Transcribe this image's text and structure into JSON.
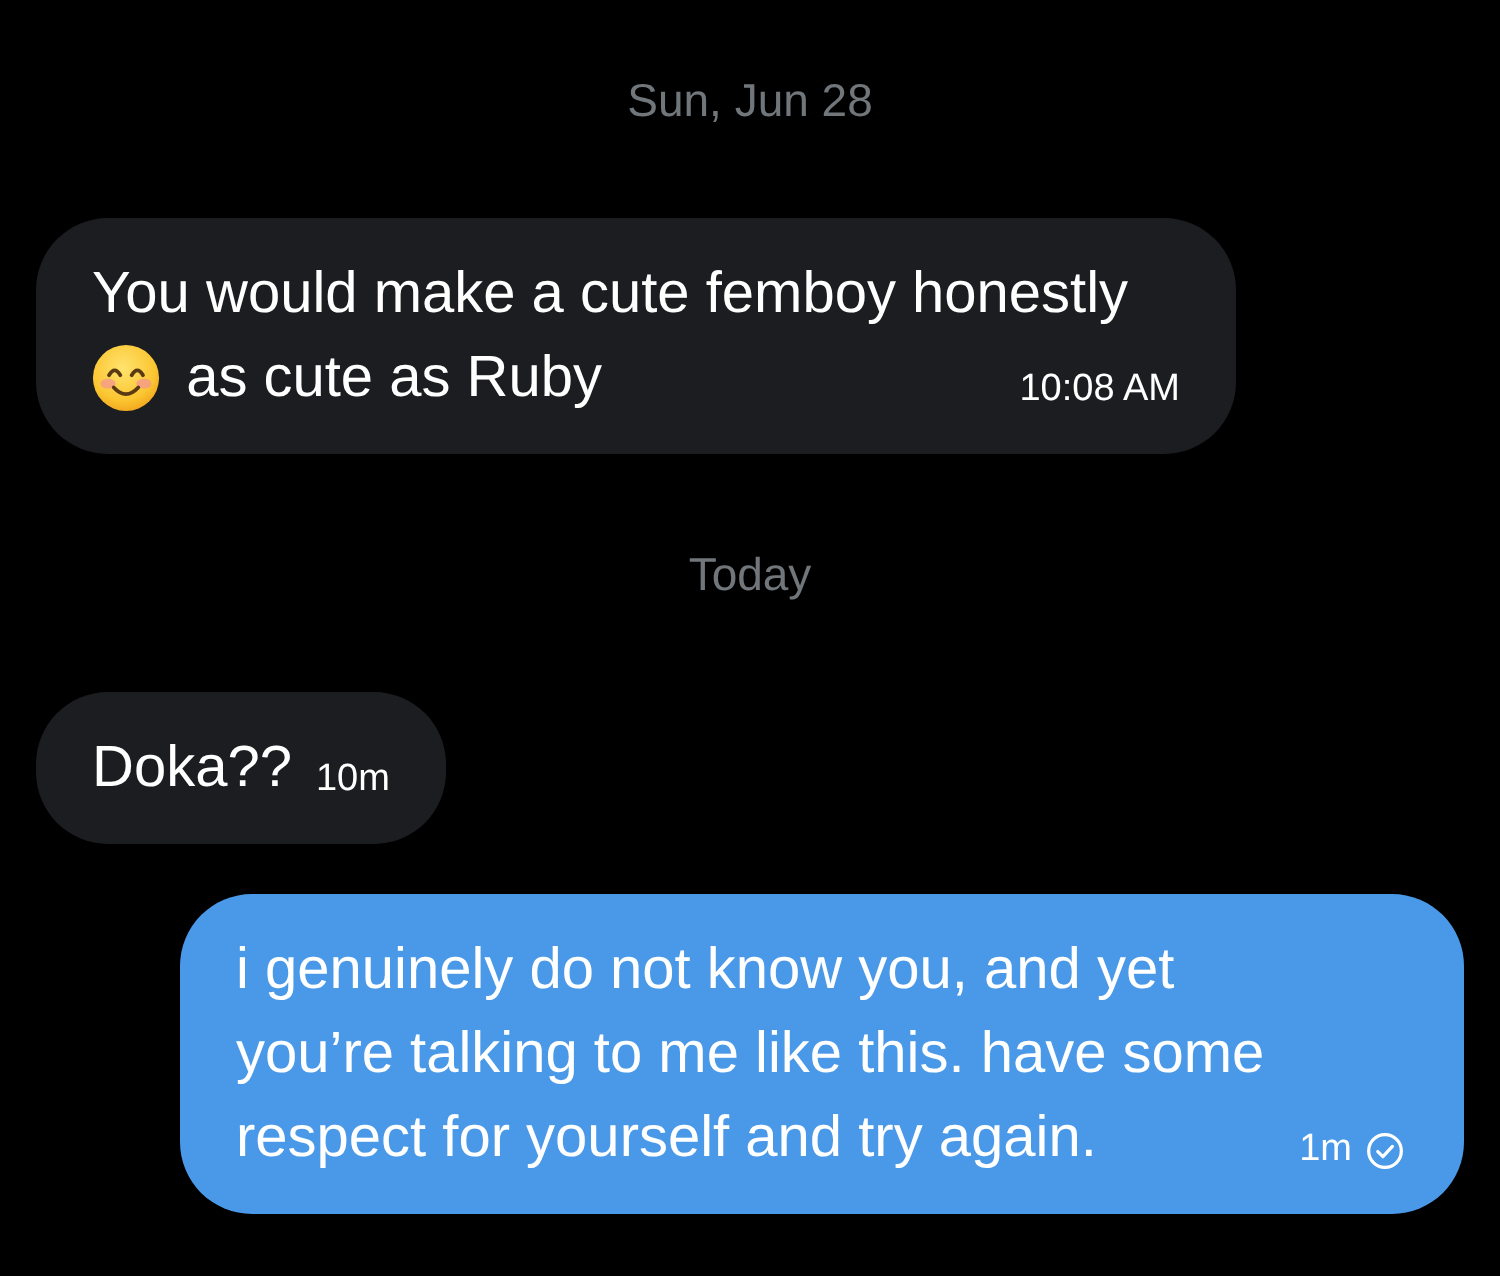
{
  "conversation": [
    {
      "kind": "date",
      "text": "Sun, Jun 28"
    },
    {
      "kind": "received",
      "parts": [
        {
          "kind": "text",
          "text": "You would make a cute femboy honestly"
        },
        {
          "kind": "emoji"
        },
        {
          "kind": "text",
          "text": "as cute as Ruby"
        }
      ],
      "time": "10:08 AM"
    },
    {
      "kind": "date",
      "text": "Today"
    },
    {
      "kind": "received",
      "parts": [
        {
          "kind": "text",
          "text": "Doka??"
        }
      ],
      "time": "10m"
    },
    {
      "kind": "sent",
      "parts": [
        {
          "kind": "text",
          "text": "i genuinely do not know you, and yet you’re talking to me like this. have some respect for yourself and try again."
        }
      ],
      "time": "1m",
      "seen": true
    }
  ]
}
